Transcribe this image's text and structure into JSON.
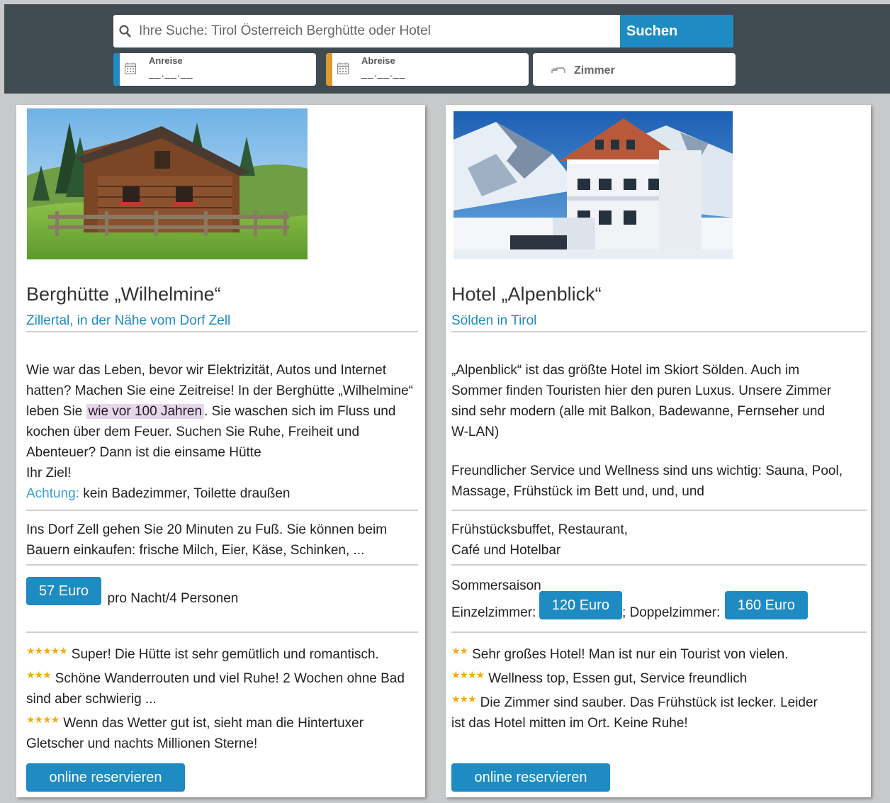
{
  "header": {
    "search_placeholder": "Ihre Suche: Tirol Österreich Berghütte oder Hotel",
    "search_button": "Suchen",
    "arrival_label": "Anreise",
    "arrival_value": "__.__.__",
    "departure_label": "Abreise",
    "departure_value": "__.__.__",
    "rooms_label": "Zimmer"
  },
  "colors": {
    "header_bg": "#404a51",
    "brand_blue": "#1e8bc3",
    "arrival_accent": "#1e8bc3",
    "departure_accent": "#e09a2b",
    "star": "#f3ae0a",
    "highlight": "#e6d6ea"
  },
  "listings": [
    {
      "image_icon": "mountain-hut-photo",
      "title": "Berghütte „Wilhelmine“",
      "location": "Zillertal, in der Nähe vom Dorf Zell",
      "description_parts": {
        "part1": "Wie war das Leben, bevor wir Elektrizität, Autos und Internet hatten? Machen Sie eine Zeitreise! In der Berghütte „Wilhelmine“ leben Sie",
        "highlight": "wie vor 100 Jahren",
        "part2": ". Sie waschen sich im Fluss und kochen über dem Feuer. Suchen Sie Ruhe, Freiheit und Abenteuer? Dann ist die einsame Hütte",
        "part3": "Ihr Ziel!"
      },
      "warning_label": "Achtung:",
      "warning_text": "kein Badezimmer, Toilette draußen",
      "info": "Ins Dorf Zell gehen Sie 20 Minuten zu Fuß. Sie können beim Bauern einkaufen: frische Milch, Eier, Käse, Schinken, ...",
      "price": "57 Euro",
      "price_note": "pro Nacht/4 Personen",
      "reviews": [
        {
          "stars": 5,
          "star_text": "★★★★★",
          "text": "Super! Die Hütte ist sehr gemütlich und romantisch."
        },
        {
          "stars": 3,
          "star_text": "★★★",
          "text": "Schöne Wanderrouten und viel Ruhe! 2 Wochen ohne Bad sind aber schwierig ..."
        },
        {
          "stars": 4,
          "star_text": "★★★★",
          "text": "Wenn das Wetter gut ist, sieht man die Hintertuxer Gletscher und nachts Millionen Sterne!"
        }
      ],
      "button": "online reservieren"
    },
    {
      "image_icon": "hotel-photo",
      "title": "Hotel „Alpenblick“",
      "location": "Sölden in Tirol",
      "description": "„Alpenblick“ ist das größte Hotel im Skiort Sölden. Auch im Sommer finden Touristen hier den puren Luxus. Unsere Zimmer sind sehr modern (alle mit Balkon, Badewanne, Fernseher und W-LAN)",
      "description2": "Freundlicher Service und Wellness sind uns wichtig: Sauna, Pool, Massage, Frühstück im Bett und, und, und",
      "info_line1": "Frühstücksbuffet, Restaurant,",
      "info_line2": "Café und Hotelbar",
      "season": "Sommersaison",
      "single_label": "Einzelzimmer:",
      "single_price": "120 Euro",
      "double_label": "; Doppelzimmer:",
      "double_price": "160 Euro",
      "reviews": [
        {
          "stars": 2,
          "star_text": "★★",
          "text": "Sehr großes Hotel! Man ist nur ein Tourist von vielen."
        },
        {
          "stars": 4,
          "star_text": "★★★★",
          "text": "Wellness top, Essen gut, Service freundlich"
        },
        {
          "stars": 3,
          "star_text": "★★★",
          "text": "Die Zimmer sind sauber. Das Frühstück ist lecker. Leider ist das Hotel mitten im Ort. Keine Ruhe!"
        }
      ],
      "button": "online reservieren"
    }
  ]
}
